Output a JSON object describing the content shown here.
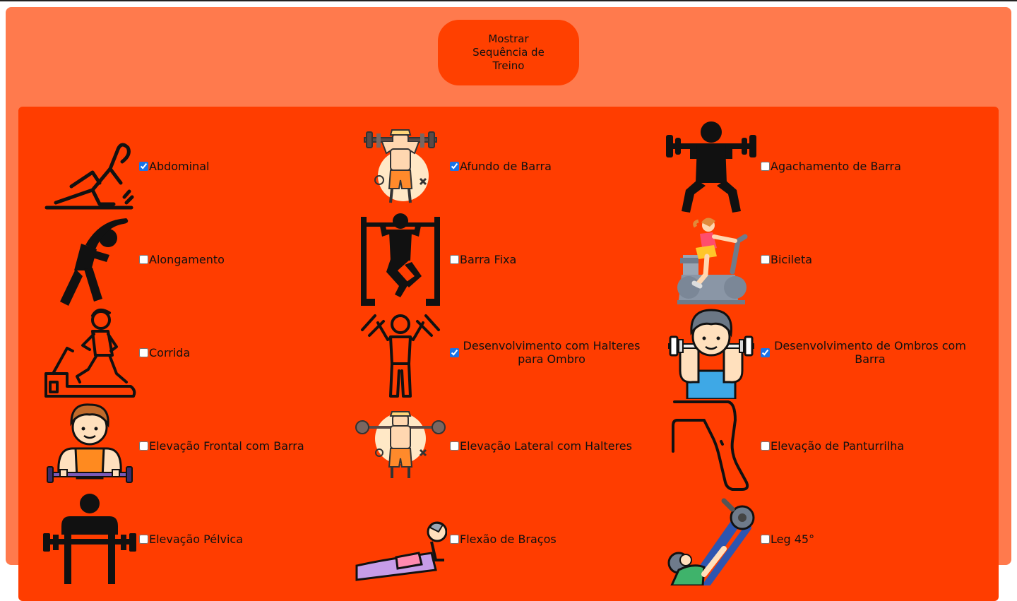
{
  "header": {
    "show_button_label": "Mostrar Sequência de Treino"
  },
  "exercises": [
    {
      "label": "Abdominal",
      "checked": true,
      "icon": "situp-icon"
    },
    {
      "label": "Afundo de Barra",
      "checked": true,
      "icon": "barbell-lunge-icon"
    },
    {
      "label": "Agachamento de Barra",
      "checked": false,
      "icon": "barbell-squat-icon"
    },
    {
      "label": "Alongamento",
      "checked": false,
      "icon": "stretching-icon"
    },
    {
      "label": "Barra Fixa",
      "checked": false,
      "icon": "pull-up-icon"
    },
    {
      "label": "Bicileta",
      "checked": false,
      "icon": "exercise-bike-icon"
    },
    {
      "label": "Corrida",
      "checked": false,
      "icon": "treadmill-icon"
    },
    {
      "label": "Desenvolvimento com Halteres para Ombro",
      "checked": true,
      "icon": "dumbbell-press-icon"
    },
    {
      "label": "Desenvolvimento de Ombros com Barra",
      "checked": true,
      "icon": "barbell-shoulder-press-icon"
    },
    {
      "label": "Elevação Frontal com Barra",
      "checked": false,
      "icon": "front-raise-icon"
    },
    {
      "label": "Elevação Lateral com Halteres",
      "checked": false,
      "icon": "lateral-raise-icon"
    },
    {
      "label": "Elevação de Panturrilha",
      "checked": false,
      "icon": "calf-raise-icon"
    },
    {
      "label": "Elevação Pélvica",
      "checked": false,
      "icon": "hip-thrust-icon"
    },
    {
      "label": "Flexão de Braços",
      "checked": false,
      "icon": "push-up-icon"
    },
    {
      "label": "Leg 45°",
      "checked": false,
      "icon": "leg-press-icon"
    }
  ],
  "colors": {
    "page_bg": "#ff7a4d",
    "panel_bg": "#ff3d00",
    "button_bg": "#ff4000",
    "checkbox_accent": "#1a73e8"
  }
}
